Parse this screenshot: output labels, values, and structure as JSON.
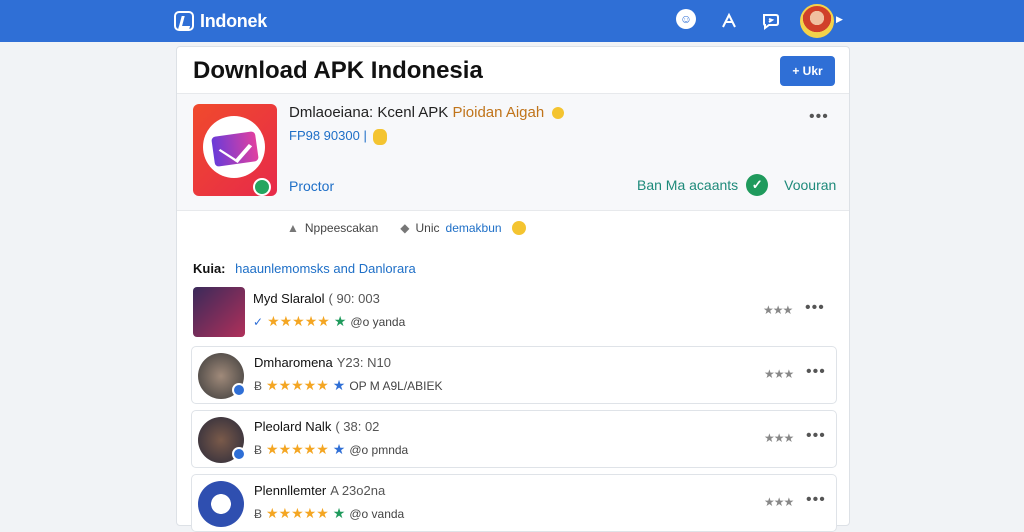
{
  "header": {
    "brand": "Indonek",
    "face_icon": "☺"
  },
  "main": {
    "title": "Download APK Indonesia",
    "add_button": "+ Ukr"
  },
  "featured": {
    "title_main": "Dmlaoeiana: Kcenl APK",
    "title_accent": "Pioidan Aigah",
    "subtitle": "FP98 90300 |",
    "tag": "Proctor",
    "status": "Ban Ma acaants",
    "status_link": "Voouran",
    "dots": "•••"
  },
  "meta": {
    "label1": "Nppeescakan",
    "label2_prefix": "Unic",
    "label2_accent": "demakbun"
  },
  "section": {
    "label": "Kuia:",
    "text": "haaunlemomsks and Danlorara"
  },
  "items": [
    {
      "name": "Myd Slaralol",
      "sub": "( 90: 003",
      "prefix": "✓",
      "stars": "★★★★★",
      "mark": "★",
      "meta": "@o yanda",
      "right_stars": "★★★",
      "dots": "•••"
    },
    {
      "name": "Dmharomena",
      "sub": "Y23: N10",
      "prefix": "Ƀ",
      "stars": "★★★★★",
      "mark": "★",
      "meta": "OP M A9L/ABIEK",
      "right_stars": "★★★",
      "dots": "•••"
    },
    {
      "name": "Pleolard Nalk",
      "sub": "( 38: 02",
      "prefix": "Ƀ",
      "stars": "★★★★★",
      "mark": "★",
      "meta": "@o pmnda",
      "right_stars": "★★★",
      "dots": "•••"
    },
    {
      "name": "Plennllemter",
      "sub": "A 23o2na",
      "prefix": "Ƀ",
      "stars": "★★★★★",
      "mark": "★",
      "meta": "@o vanda",
      "right_stars": "★★★",
      "dots": "•••"
    }
  ],
  "colors": {
    "topbar": "#2f6fd6",
    "accent_blue": "#1e6fc7",
    "star": "#f4a623",
    "success": "#1f9a5c"
  }
}
